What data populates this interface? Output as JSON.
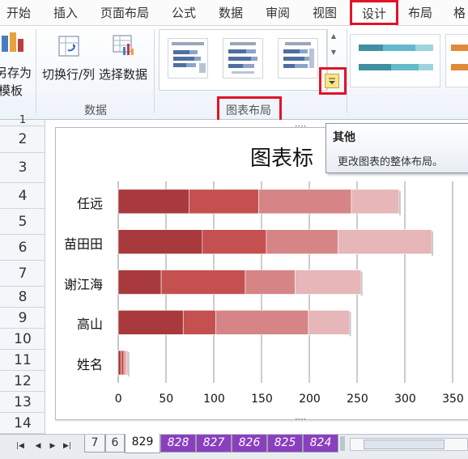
{
  "ribbon": {
    "tabs": [
      {
        "label": "开始"
      },
      {
        "label": "插入"
      },
      {
        "label": "页面布局"
      },
      {
        "label": "公式"
      },
      {
        "label": "数据"
      },
      {
        "label": "审阅"
      },
      {
        "label": "视图"
      },
      {
        "label": "设计",
        "active": true
      },
      {
        "label": "布局"
      },
      {
        "label": "格"
      }
    ],
    "save_template_label_line1": "另存为",
    "save_template_label_line2": "模板",
    "switch_row_col_label": "切换行/列",
    "select_data_label": "选择数据",
    "data_group_label": "数据",
    "chart_layouts_group_label": "图表布局",
    "accent_color": "#e0142a"
  },
  "tooltip": {
    "title": "其他",
    "description": "更改图表的整体布局。"
  },
  "sheet": {
    "row_numbers": [
      "1",
      "2",
      "3",
      "4",
      "5",
      "6",
      "7",
      "8",
      "9",
      "10",
      "11",
      "12",
      "13",
      "14"
    ]
  },
  "chart_data": {
    "type": "bar",
    "stacked": true,
    "orientation": "horizontal",
    "title": "图表标",
    "categories": [
      "任远",
      "苗田田",
      "谢江海",
      "高山",
      "姓名"
    ],
    "series": [
      {
        "color": "#a83a3d",
        "values": [
          74,
          88,
          45,
          68,
          3
        ]
      },
      {
        "color": "#c45050",
        "values": [
          73,
          67,
          88,
          34,
          3
        ]
      },
      {
        "color": "#d58585",
        "values": [
          97,
          75,
          52,
          97,
          2
        ]
      },
      {
        "color": "#e6b6b8",
        "values": [
          50,
          98,
          69,
          43,
          2
        ]
      }
    ],
    "xlim": [
      0,
      350
    ],
    "x_ticks": [
      "0",
      "50",
      "100",
      "150",
      "200",
      "250",
      "300",
      "350"
    ],
    "grid": true
  },
  "sheet_tabs": [
    {
      "label": "7",
      "style": "plain"
    },
    {
      "label": "6",
      "style": "plain"
    },
    {
      "label": "829",
      "style": "active"
    },
    {
      "label": "828",
      "style": "purple"
    },
    {
      "label": "827",
      "style": "purple"
    },
    {
      "label": "826",
      "style": "purple"
    },
    {
      "label": "825",
      "style": "purple"
    },
    {
      "label": "824",
      "style": "purple"
    }
  ]
}
